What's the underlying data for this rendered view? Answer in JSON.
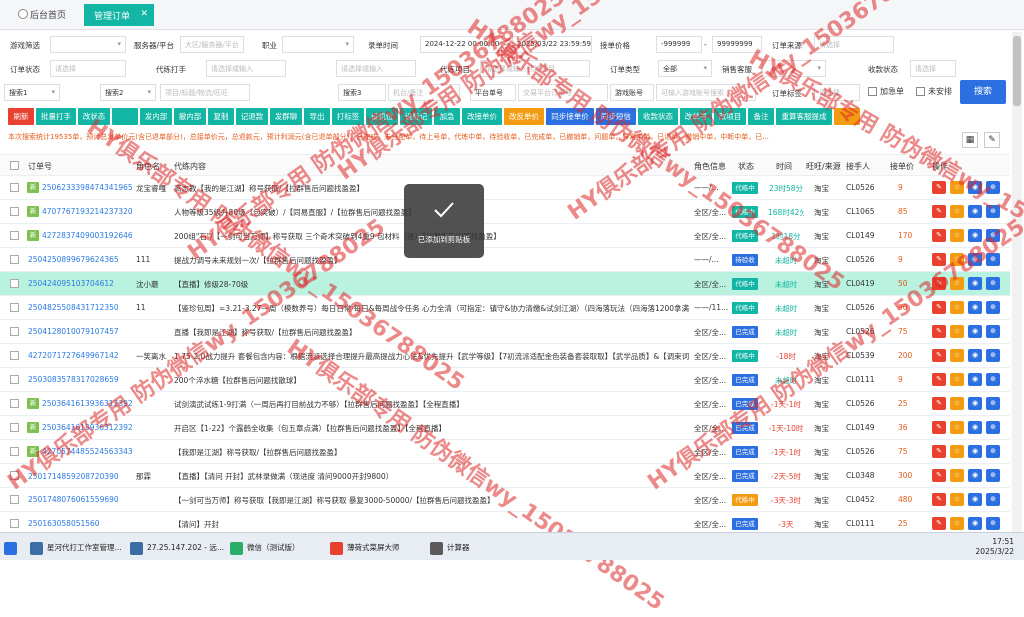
{
  "tabs": {
    "home": "后台首页",
    "active": "管理订单",
    "close": "✕"
  },
  "filters": {
    "r1": [
      {
        "label": "游戏筛选",
        "value": "",
        "ph": ""
      },
      {
        "label": "服务器/平台",
        "value": "",
        "ph": "大区/服务器/平台"
      },
      {
        "label": "职业",
        "value": "",
        "ph": ""
      },
      {
        "label": "录单时间",
        "value": "2024-12-22 00:00:00",
        "ph": ""
      },
      {
        "label": "-",
        "value": "2025/03/22 23:59:59",
        "ph": ""
      },
      {
        "label": "接单价格",
        "value": "-999999",
        "ph": ""
      },
      {
        "label": "-",
        "value": "99999999",
        "ph": ""
      },
      {
        "label": "订单来源",
        "value": "",
        "ph": "请选择"
      }
    ],
    "r2": [
      {
        "label": "订单状态",
        "value": "",
        "ph": "请选择"
      },
      {
        "label": "代练打手",
        "value": "",
        "ph": "请选择或输入"
      },
      {
        "label": "",
        "value": "",
        "ph": "请选择或输入"
      },
      {
        "label": "代练项目",
        "value": "",
        "ph": "请选择或输入代练项目"
      },
      {
        "label": "订单类型",
        "value": "全部",
        "ph": ""
      },
      {
        "label": "销售客服",
        "value": "",
        "ph": ""
      },
      {
        "label": "收款状态",
        "value": "",
        "ph": "请选择"
      }
    ],
    "r3": [
      {
        "label": "搜索1",
        "value": "",
        "ph": ""
      },
      {
        "label": "搜索2",
        "value": "",
        "ph": "项目/标题/物流/旺旺"
      },
      {
        "label": "搜索3",
        "value": "",
        "ph": "机台/备注"
      },
      {
        "label": "平台单号",
        "value": "",
        "ph": "交易平台订单号"
      },
      {
        "label": "游戏账号",
        "value": "",
        "ph": "可输入游戏账号搜索"
      },
      {
        "label": "订单标签",
        "value": "",
        "ph": "请选择"
      }
    ]
  },
  "checks": {
    "urgent": "加急单",
    "unarranged": "未安排"
  },
  "search_btn": "搜索",
  "actions": [
    {
      "label": "刷新",
      "color": "#e8412f"
    },
    {
      "label": "批量打手",
      "color": "#13b5a4"
    },
    {
      "label": "改状态",
      "color": "#13b5a4"
    },
    {
      "label": "",
      "color": "#13b5a4"
    },
    {
      "label": "发内部",
      "color": "#13b5a4"
    },
    {
      "label": "撤内部",
      "color": "#13b5a4"
    },
    {
      "label": "复制",
      "color": "#13b5a4"
    },
    {
      "label": "记退款",
      "color": "#13b5a4"
    },
    {
      "label": "发群聊",
      "color": "#13b5a4"
    },
    {
      "label": "导出",
      "color": "#13b5a4"
    },
    {
      "label": "打标签",
      "color": "#13b5a4"
    },
    {
      "label": "设机位",
      "color": "#13b5a4"
    },
    {
      "label": "设标记",
      "color": "#13b5a4"
    },
    {
      "label": "加急",
      "color": "#13b5a4"
    },
    {
      "label": "改接单价",
      "color": "#13b5a4"
    },
    {
      "label": "改反单价",
      "color": "#f39c12"
    },
    {
      "label": "同步接单价",
      "color": "#2c6fe0"
    },
    {
      "label": "同步短信",
      "color": "#2c6fe0"
    },
    {
      "label": "收款状态",
      "color": "#13b5a4"
    },
    {
      "label": "改单号",
      "color": "#13b5a4"
    },
    {
      "label": "改项目",
      "color": "#13b5a4"
    },
    {
      "label": "备注",
      "color": "#13b5a4"
    },
    {
      "label": "重算客服提成",
      "color": "#13b5a4"
    },
    {
      "label": "",
      "color": "#f39c12"
    }
  ],
  "info": "本次搜索统计19535单，预计总发单价元(含已退单部分)，总接单价元，总退款元，预计利润元(含已退单部分)，已完成，未分配单，待上号单，代练中单，待验收单，已完成单，已撤销单，问题单，异常中单，已退单，撤销中单，中断中单，已...",
  "columns": [
    "订单号",
    "角色名",
    "代练内容",
    "角色信息",
    "状态",
    "时间",
    "旺旺/来源",
    "接手人",
    "接单价",
    "操作"
  ],
  "rows": [
    {
      "new": true,
      "order": "2506233398474341965",
      "role": "龙宝睿嘎",
      "content": "高志教【我的是江湖】称号获取/【拉群售后问题找盈盈】",
      "info": "——/...",
      "status": "代练中",
      "scolor": "#13b5a4",
      "time": "23时58分",
      "tcolor": "#13b5a4",
      "src": "淘宝",
      "taker": "CL0526",
      "price": "9",
      "hl": false
    },
    {
      "new": true,
      "order": "4707767193214237320",
      "role": "",
      "content": "人物等级35级升80级（包突破）/【同易直服】/【拉群售后问题找盈盈】",
      "info": "全区/全...",
      "status": "代练中",
      "scolor": "#13b5a4",
      "time": "168时42分",
      "tcolor": "#13b5a4",
      "src": "淘宝",
      "taker": "CL1065",
      "price": "85",
      "hl": false
    },
    {
      "new": true,
      "order": "4272837409003192646,4272",
      "role": "",
      "content": "200组\"石\"/【一剑可当万师】称号获取 三个奇术突破到4重9 包材料（进）【拉群售后问题找盈盈】",
      "info": "全区/全...",
      "status": "代练中",
      "scolor": "#13b5a4",
      "time": "1时18分",
      "tcolor": "#13b5a4",
      "src": "淘宝",
      "taker": "CL0149",
      "price": "170",
      "hl": false
    },
    {
      "new": false,
      "order": "2504250899679624365",
      "role": "111",
      "content": "提战力调号未来规划一次/【拉群售后问题找盈盈】",
      "info": "——/...",
      "status": "待验收",
      "scolor": "#2c6fe0",
      "time": "未超时",
      "tcolor": "#13b5a4",
      "src": "淘宝",
      "taker": "CL0526",
      "price": "9",
      "hl": false
    },
    {
      "new": false,
      "order": "250424095103704612",
      "role": "沈小蘑",
      "content": "【直播】修级28-70级",
      "info": "全区/全...",
      "status": "代练中",
      "scolor": "#13b5a4",
      "time": "未超时",
      "tcolor": "#13b5a4",
      "src": "淘宝",
      "taker": "CL0419",
      "price": "50",
      "hl": true
    },
    {
      "new": false,
      "order": "2504825508431712350",
      "role": "11",
      "content": "【鉴珍包周】=3.21-3.27一周（模数养号）每日日常·每日&每周战令任务 心力全清（可指定：镇守&协力清缴&试剑江湖）（四海落玩法（四海落1200拿满）",
      "info": "——/11...",
      "status": "代练中",
      "scolor": "#13b5a4",
      "time": "未超时",
      "tcolor": "#13b5a4",
      "src": "淘宝",
      "taker": "CL0526",
      "price": "90",
      "hl": false
    },
    {
      "new": false,
      "order": "2504128010079107457",
      "role": "",
      "content": "直播【我即是江湖】称号获取/【拉群售后问题找盈盈】",
      "info": "全区/全...",
      "status": "已完成",
      "scolor": "#2c6fe0",
      "time": "未超时",
      "tcolor": "#13b5a4",
      "src": "淘宝",
      "taker": "CL0526",
      "price": "75",
      "hl": false
    },
    {
      "new": false,
      "order": "4272071727649967142",
      "role": "一笑离水",
      "content": "1.75-2.0战力提升 套餐包含内容：根据流派选择合理提升最高提战力心法&优先提升【武学等级】【7初流派适配金色装备套装取取】【武学品质】&【调束词条】",
      "info": "全区/全...",
      "status": "代练中",
      "scolor": "#13b5a4",
      "time": "-18时",
      "tcolor": "#e8412f",
      "src": "淘宝",
      "taker": "CL0539",
      "price": "200",
      "hl": false
    },
    {
      "new": false,
      "order": "2503083578317028659",
      "role": "",
      "content": "200个淬水糖【拉群售后问题找散球】",
      "info": "全区/全...",
      "status": "已完成",
      "scolor": "#2c6fe0",
      "time": "未超时",
      "tcolor": "#13b5a4",
      "src": "淘宝",
      "taker": "CL0111",
      "price": "9",
      "hl": false
    },
    {
      "new": true,
      "order": "2503641613936312392",
      "role": "",
      "content": "试剑演武试练1-9打满（一周后再打目前战力不够）【拉群售后问题找盈盈】【全程直播】",
      "info": "全区/全...",
      "status": "已完成",
      "scolor": "#2c6fe0",
      "time": "-1天-1时",
      "tcolor": "#e8412f",
      "src": "淘宝",
      "taker": "CL0526",
      "price": "25",
      "hl": false
    },
    {
      "new": true,
      "order": "2503641613936312392",
      "role": "",
      "content": "开启区【1-22】个露鹤全收集（包五章点满）【拉群售后问题找盈盈】【全程直播】",
      "info": "全区/全...",
      "status": "已完成",
      "scolor": "#2c6fe0",
      "time": "-1天-10时",
      "tcolor": "#e8412f",
      "src": "淘宝",
      "taker": "CL0149",
      "price": "36",
      "hl": false
    },
    {
      "new": true,
      "order": "4270574485524563343",
      "role": "",
      "content": "【我即是江湖】称号获取/【拉群售后问题找盈盈】",
      "info": "全区/全...",
      "status": "已完成",
      "scolor": "#2c6fe0",
      "time": "-1天-1时",
      "tcolor": "#e8412f",
      "src": "淘宝",
      "taker": "CL0526",
      "price": "75",
      "hl": false
    },
    {
      "new": false,
      "order": "2501714859208720390；2502032",
      "role": "那霖",
      "content": "【直播】【清问 开封】武林录做满（现进度 清问9000开封9800）",
      "info": "全区/全...",
      "status": "已完成",
      "scolor": "#2c6fe0",
      "time": "-2天-5时",
      "tcolor": "#e8412f",
      "src": "淘宝",
      "taker": "CL0348",
      "price": "300",
      "hl": false
    },
    {
      "new": false,
      "order": "2501748076061559690",
      "role": "",
      "content": "【一剑可当万师】称号获取【我即是江湖】称号获取 暴复3000-50000/【拉群售后问题找盈盈】",
      "info": "全区/全...",
      "status": "代练中",
      "scolor": "#f39c12",
      "time": "-3天-3时",
      "tcolor": "#e8412f",
      "src": "淘宝",
      "taker": "CL0452",
      "price": "480",
      "hl": false
    },
    {
      "new": false,
      "order": "250163058051560",
      "role": "",
      "content": "【清问】开封",
      "info": "全区/全...",
      "status": "已完成",
      "scolor": "#2c6fe0",
      "time": "-3天",
      "tcolor": "#e8412f",
      "src": "淘宝",
      "taker": "CL0111",
      "price": "25",
      "hl": false
    }
  ],
  "toast": "已添加到剪贴板",
  "taskbar": [
    {
      "label": "星河代打工作室管理...",
      "color": "#3a6ea5"
    },
    {
      "label": "27.25.147.202 - 远...",
      "color": "#3a6ea5"
    },
    {
      "label": "微信（测试版）",
      "color": "#2aae67"
    },
    {
      "label": "薄荷式菜屏大师",
      "color": "#e8412f"
    },
    {
      "label": "计算器",
      "color": "#5a5a5a"
    }
  ],
  "clock": {
    "time": "17:51",
    "date": "2025/3/22"
  },
  "watermark": "HY俱乐部专用 防伪微信wy_15036788025"
}
